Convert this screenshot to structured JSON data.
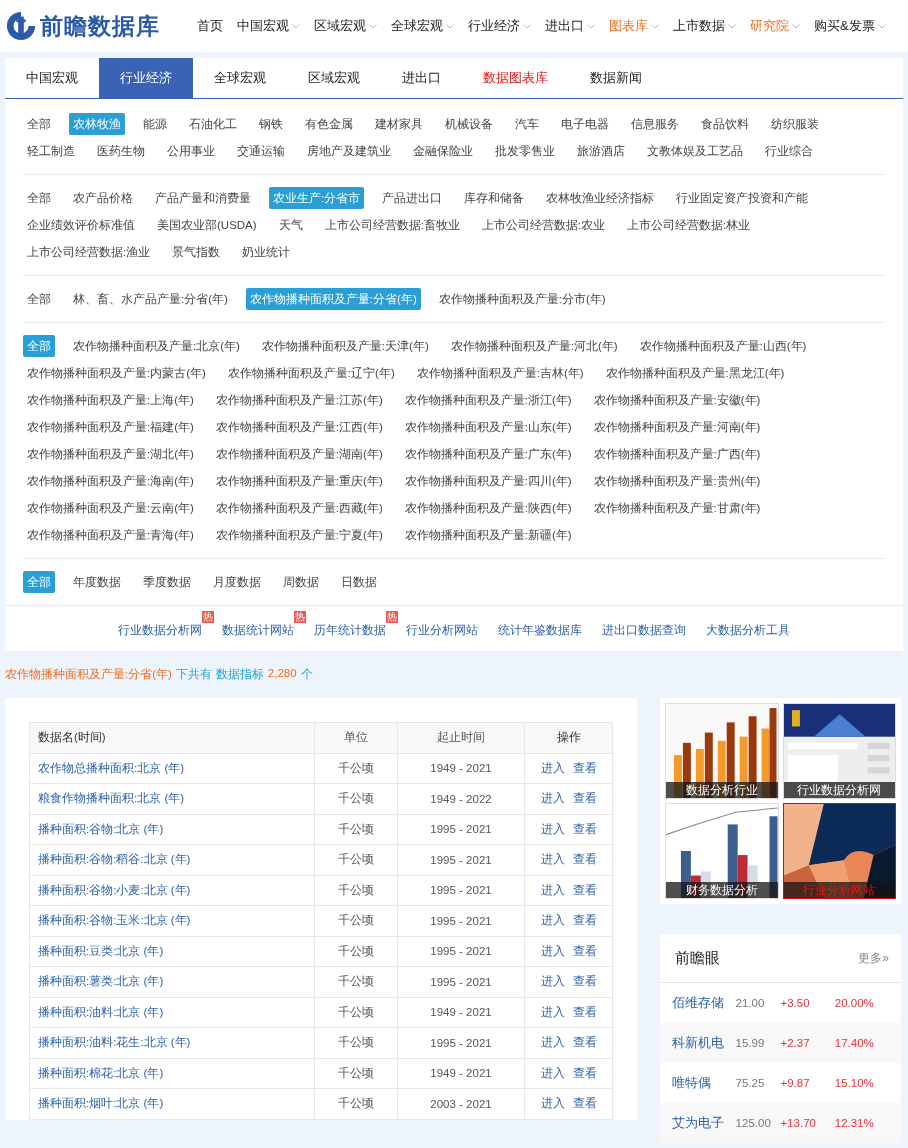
{
  "logo": {
    "name": "前瞻数据库"
  },
  "nav": [
    {
      "label": "首页",
      "dropdown": false,
      "highlight": false
    },
    {
      "label": "中国宏观",
      "dropdown": true,
      "highlight": false
    },
    {
      "label": "区域宏观",
      "dropdown": true,
      "highlight": false
    },
    {
      "label": "全球宏观",
      "dropdown": true,
      "highlight": false
    },
    {
      "label": "行业经济",
      "dropdown": true,
      "highlight": false
    },
    {
      "label": "进出口",
      "dropdown": true,
      "highlight": false
    },
    {
      "label": "图表库",
      "dropdown": true,
      "highlight": true
    },
    {
      "label": "上市数据",
      "dropdown": true,
      "highlight": false
    },
    {
      "label": "研究院",
      "dropdown": true,
      "highlight": true
    },
    {
      "label": "购买&发票",
      "dropdown": true,
      "highlight": false
    }
  ],
  "tabs": [
    {
      "label": "中国宏观",
      "selected": false,
      "highlight": false
    },
    {
      "label": "行业经济",
      "selected": true,
      "highlight": false
    },
    {
      "label": "全球宏观",
      "selected": false,
      "highlight": false
    },
    {
      "label": "区域宏观",
      "selected": false,
      "highlight": false
    },
    {
      "label": "进出口",
      "selected": false,
      "highlight": false
    },
    {
      "label": "数据图表库",
      "selected": false,
      "highlight": true
    },
    {
      "label": "数据新闻",
      "selected": false,
      "highlight": false
    }
  ],
  "filter_groups": [
    {
      "options": [
        {
          "label": "全部",
          "selected": false
        },
        {
          "label": "农林牧渔",
          "selected": true
        },
        {
          "label": "能源",
          "selected": false
        },
        {
          "label": "石油化工",
          "selected": false
        },
        {
          "label": "钢铁",
          "selected": false
        },
        {
          "label": "有色金属",
          "selected": false
        },
        {
          "label": "建材家具",
          "selected": false
        },
        {
          "label": "机械设备",
          "selected": false
        },
        {
          "label": "汽车",
          "selected": false
        },
        {
          "label": "电子电器",
          "selected": false
        },
        {
          "label": "信息服务",
          "selected": false
        },
        {
          "label": "食品饮料",
          "selected": false
        },
        {
          "label": "纺织服装",
          "selected": false
        },
        {
          "label": "轻工制造",
          "selected": false
        },
        {
          "label": "医药生物",
          "selected": false
        },
        {
          "label": "公用事业",
          "selected": false
        },
        {
          "label": "交通运输",
          "selected": false
        },
        {
          "label": "房地产及建筑业",
          "selected": false
        },
        {
          "label": "金融保险业",
          "selected": false
        },
        {
          "label": "批发零售业",
          "selected": false
        },
        {
          "label": "旅游酒店",
          "selected": false
        },
        {
          "label": "文教体娱及工艺品",
          "selected": false
        },
        {
          "label": "行业综合",
          "selected": false
        }
      ]
    },
    {
      "options": [
        {
          "label": "全部",
          "selected": false
        },
        {
          "label": "农产品价格",
          "selected": false
        },
        {
          "label": "产品产量和消费量",
          "selected": false
        },
        {
          "label": "农业生产:分省市",
          "selected": true
        },
        {
          "label": "产品进出口",
          "selected": false
        },
        {
          "label": "库存和储备",
          "selected": false
        },
        {
          "label": "农林牧渔业经济指标",
          "selected": false
        },
        {
          "label": "行业固定资产投资和产能",
          "selected": false
        },
        {
          "label": "企业绩效评价标准值",
          "selected": false
        },
        {
          "label": "美国农业部(USDA)",
          "selected": false
        },
        {
          "label": "天气",
          "selected": false
        },
        {
          "label": "上市公司经营数据:畜牧业",
          "selected": false
        },
        {
          "label": "上市公司经营数据:农业",
          "selected": false
        },
        {
          "label": "上市公司经营数据:林业",
          "selected": false
        },
        {
          "label": "上市公司经营数据:渔业",
          "selected": false
        },
        {
          "label": "景气指数",
          "selected": false
        },
        {
          "label": "奶业统计",
          "selected": false
        }
      ]
    },
    {
      "options": [
        {
          "label": "全部",
          "selected": false
        },
        {
          "label": "林、畜、水产品产量:分省(年)",
          "selected": false
        },
        {
          "label": "农作物播种面积及产量:分省(年)",
          "selected": true
        },
        {
          "label": "农作物播种面积及产量:分市(年)",
          "selected": false
        }
      ]
    },
    {
      "options": [
        {
          "label": "全部",
          "selected": true
        },
        {
          "label": "农作物播种面积及产量:北京(年)",
          "selected": false
        },
        {
          "label": "农作物播种面积及产量:天津(年)",
          "selected": false
        },
        {
          "label": "农作物播种面积及产量:河北(年)",
          "selected": false
        },
        {
          "label": "农作物播种面积及产量:山西(年)",
          "selected": false
        },
        {
          "label": "农作物播种面积及产量:内蒙古(年)",
          "selected": false
        },
        {
          "label": "农作物播种面积及产量:辽宁(年)",
          "selected": false
        },
        {
          "label": "农作物播种面积及产量:吉林(年)",
          "selected": false
        },
        {
          "label": "农作物播种面积及产量:黑龙江(年)",
          "selected": false
        },
        {
          "label": "农作物播种面积及产量:上海(年)",
          "selected": false
        },
        {
          "label": "农作物播种面积及产量:江苏(年)",
          "selected": false
        },
        {
          "label": "农作物播种面积及产量:浙江(年)",
          "selected": false
        },
        {
          "label": "农作物播种面积及产量:安徽(年)",
          "selected": false
        },
        {
          "label": "农作物播种面积及产量:福建(年)",
          "selected": false
        },
        {
          "label": "农作物播种面积及产量:江西(年)",
          "selected": false
        },
        {
          "label": "农作物播种面积及产量:山东(年)",
          "selected": false
        },
        {
          "label": "农作物播种面积及产量:河南(年)",
          "selected": false
        },
        {
          "label": "农作物播种面积及产量:湖北(年)",
          "selected": false
        },
        {
          "label": "农作物播种面积及产量:湖南(年)",
          "selected": false
        },
        {
          "label": "农作物播种面积及产量:广东(年)",
          "selected": false
        },
        {
          "label": "农作物播种面积及产量:广西(年)",
          "selected": false
        },
        {
          "label": "农作物播种面积及产量:海南(年)",
          "selected": false
        },
        {
          "label": "农作物播种面积及产量:重庆(年)",
          "selected": false
        },
        {
          "label": "农作物播种面积及产量:四川(年)",
          "selected": false
        },
        {
          "label": "农作物播种面积及产量:贵州(年)",
          "selected": false
        },
        {
          "label": "农作物播种面积及产量:云南(年)",
          "selected": false
        },
        {
          "label": "农作物播种面积及产量:西藏(年)",
          "selected": false
        },
        {
          "label": "农作物播种面积及产量:陕西(年)",
          "selected": false
        },
        {
          "label": "农作物播种面积及产量:甘肃(年)",
          "selected": false
        },
        {
          "label": "农作物播种面积及产量:青海(年)",
          "selected": false
        },
        {
          "label": "农作物播种面积及产量:宁夏(年)",
          "selected": false
        },
        {
          "label": "农作物播种面积及产量:新疆(年)",
          "selected": false
        }
      ]
    },
    {
      "options": [
        {
          "label": "全部",
          "selected": true
        },
        {
          "label": "年度数据",
          "selected": false
        },
        {
          "label": "季度数据",
          "selected": false
        },
        {
          "label": "月度数据",
          "selected": false
        },
        {
          "label": "周数据",
          "selected": false
        },
        {
          "label": "日数据",
          "selected": false
        }
      ]
    }
  ],
  "quick_links": [
    {
      "label": "行业数据分析网",
      "badge": "热"
    },
    {
      "label": "数据统计网站",
      "badge": "热"
    },
    {
      "label": "历年统计数据",
      "badge": "热"
    },
    {
      "label": "行业分析网站"
    },
    {
      "label": "统计年鉴数据库"
    },
    {
      "label": "进出口数据查询"
    },
    {
      "label": "大数据分析工具"
    }
  ],
  "summary": {
    "category": "农作物播种面积及产量:分省(年)",
    "text": "下共有",
    "label": "数据指标",
    "count": "2,280",
    "unit": "个"
  },
  "table": {
    "columns": [
      "数据名(时间)",
      "单位",
      "起止时间",
      "操作"
    ],
    "rows": [
      {
        "name": "农作物总播种面积:北京 (年)",
        "unit": "千公顷",
        "period": "1949 - 2021",
        "actions": [
          "进入",
          "查看"
        ]
      },
      {
        "name": "粮食作物播种面积:北京 (年)",
        "unit": "千公顷",
        "period": "1949 - 2022",
        "actions": [
          "进入",
          "查看"
        ]
      },
      {
        "name": "播种面积:谷物:北京 (年)",
        "unit": "千公顷",
        "period": "1995 - 2021",
        "actions": [
          "进入",
          "查看"
        ]
      },
      {
        "name": "播种面积:谷物:稻谷:北京 (年)",
        "unit": "千公顷",
        "period": "1995 - 2021",
        "actions": [
          "进入",
          "查看"
        ]
      },
      {
        "name": "播种面积:谷物:小麦:北京 (年)",
        "unit": "千公顷",
        "period": "1995 - 2021",
        "actions": [
          "进入",
          "查看"
        ]
      },
      {
        "name": "播种面积:谷物:玉米:北京 (年)",
        "unit": "千公顷",
        "period": "1995 - 2021",
        "actions": [
          "进入",
          "查看"
        ]
      },
      {
        "name": "播种面积:豆类:北京 (年)",
        "unit": "千公顷",
        "period": "1995 - 2021",
        "actions": [
          "进入",
          "查看"
        ]
      },
      {
        "name": "播种面积:薯类:北京 (年)",
        "unit": "千公顷",
        "period": "1995 - 2021",
        "actions": [
          "进入",
          "查看"
        ]
      },
      {
        "name": "播种面积:油料:北京 (年)",
        "unit": "千公顷",
        "period": "1949 - 2021",
        "actions": [
          "进入",
          "查看"
        ]
      },
      {
        "name": "播种面积:油料:花生:北京 (年)",
        "unit": "千公顷",
        "period": "1995 - 2021",
        "actions": [
          "进入",
          "查看"
        ]
      },
      {
        "name": "播种面积:棉花:北京 (年)",
        "unit": "千公顷",
        "period": "1949 - 2021",
        "actions": [
          "进入",
          "查看"
        ]
      },
      {
        "name": "播种面积:烟叶:北京 (年)",
        "unit": "千公顷",
        "period": "2003 - 2021",
        "actions": [
          "进入",
          "查看"
        ]
      }
    ]
  },
  "ads": [
    {
      "kind": "picture",
      "caption": "数据分析行业",
      "highlighted": false
    },
    {
      "kind": "picture",
      "caption": "行业数据分析网",
      "highlighted": false
    },
    {
      "kind": "picture",
      "caption": "财务数据分析",
      "highlighted": false
    },
    {
      "kind": "picture",
      "caption": "行业分析网站",
      "highlighted": true
    }
  ],
  "stocks": {
    "title": "前瞻眼",
    "more": "更多»",
    "rows": [
      {
        "name": "佰维存储",
        "price": "21.00",
        "change": "+3.50",
        "percent": "20.00%"
      },
      {
        "name": "科新机电",
        "price": "15.99",
        "change": "+2.37",
        "percent": "17.40%"
      },
      {
        "name": "唯特偶",
        "price": "75.25",
        "change": "+9.87",
        "percent": "15.10%"
      },
      {
        "name": "艾为电子",
        "price": "125.00",
        "change": "+13.70",
        "percent": "12.31%"
      }
    ]
  }
}
